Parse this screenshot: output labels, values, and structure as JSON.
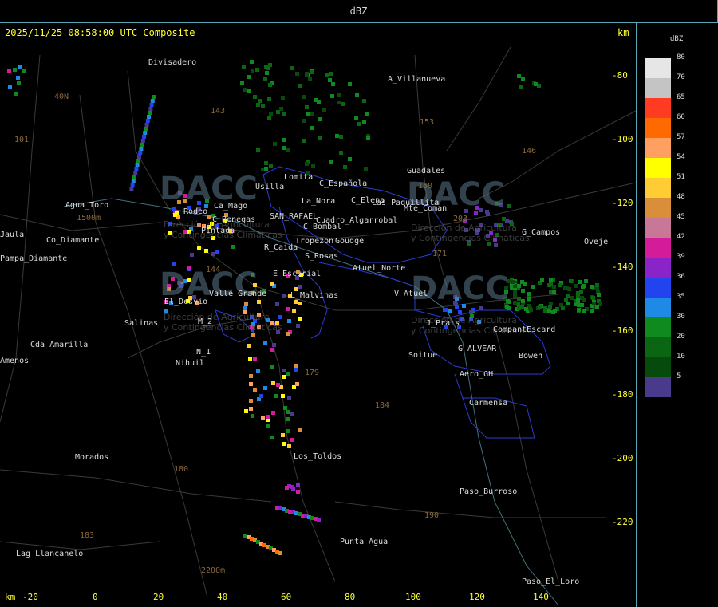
{
  "header": {
    "title": "dBZ"
  },
  "plot": {
    "timestamp": "2025/11/25 08:58:00 UTC Composite",
    "unit_top": "km",
    "unit_bottom": "km"
  },
  "axes": {
    "y_ticks": [
      "-80",
      "-100",
      "-120",
      "-140",
      "-160",
      "-180",
      "-200",
      "-220"
    ],
    "x_ticks": [
      "-20",
      "0",
      "20",
      "40",
      "60",
      "80",
      "100",
      "120",
      "140"
    ]
  },
  "legend": {
    "title": "dBZ",
    "entries": [
      {
        "label": "80",
        "color": "#e6e6e6"
      },
      {
        "label": "70",
        "color": "#c4c4c4"
      },
      {
        "label": "65",
        "color": "#ff3c22"
      },
      {
        "label": "60",
        "color": "#ff6a00"
      },
      {
        "label": "57",
        "color": "#ffa061"
      },
      {
        "label": "54",
        "color": "#ffff00"
      },
      {
        "label": "51",
        "color": "#ffcc33"
      },
      {
        "label": "48",
        "color": "#d98e3a"
      },
      {
        "label": "45",
        "color": "#c87896"
      },
      {
        "label": "42",
        "color": "#d41c9a"
      },
      {
        "label": "39",
        "color": "#8b24c8"
      },
      {
        "label": "36",
        "color": "#2244ee"
      },
      {
        "label": "35",
        "color": "#1e8ae6"
      },
      {
        "label": "30",
        "color": "#0f8a1e"
      },
      {
        "label": "20",
        "color": "#0b6614"
      },
      {
        "label": "10",
        "color": "#064a0c"
      },
      {
        "label": "5",
        "color": "#4a3a8c"
      }
    ]
  },
  "watermark": {
    "brand": "DACC",
    "line1": "Dirección de Agricultura",
    "line2": "y Contingencias Climáticas"
  },
  "places": [
    "Divisadero",
    "A_Villanueva",
    "Agua_Toro",
    "Jaula",
    "Pampa_Diamante",
    "Co_Diamante",
    "Rodeo",
    "Ca_Mago",
    "C_Benegas",
    "Pintada",
    "SAN_RAFAEL",
    "Cuadro_Algarrobal",
    "C_Bombal",
    "Tropezon",
    "Goudge",
    "R_Caida",
    "S_Rosas",
    "Atuel_Norte",
    "E_Escurial",
    "Valle_Grande",
    "L_Malvinas",
    "El_Desvio",
    "Salinas",
    "M_2",
    "N_1",
    "Nihuil",
    "Cda_Amarilla",
    "Amenos",
    "Lomita",
    "Usilla",
    "La_Nora",
    "C_Española",
    "C_Elena",
    "Las_Paquillita",
    "Guadales",
    "Mte_Coman",
    "G_Campos",
    "Oveje",
    "V_Atuel",
    "J_Prats",
    "CompantEscard",
    "G_ALVEAR",
    "Soitue",
    "Bowen",
    "Aero_GH",
    "Carmensa",
    "Morados",
    "Los_Toldos",
    "Paso_Burroso",
    "Punta_Agua",
    "Lag_Llancanelo",
    "Paso_El_Loro"
  ],
  "road_numbers": [
    "101",
    "40N",
    "143",
    "153",
    "146",
    "150",
    "203",
    "171",
    "144",
    "179",
    "184",
    "180",
    "183",
    "190",
    "1500m",
    "2200m"
  ]
}
